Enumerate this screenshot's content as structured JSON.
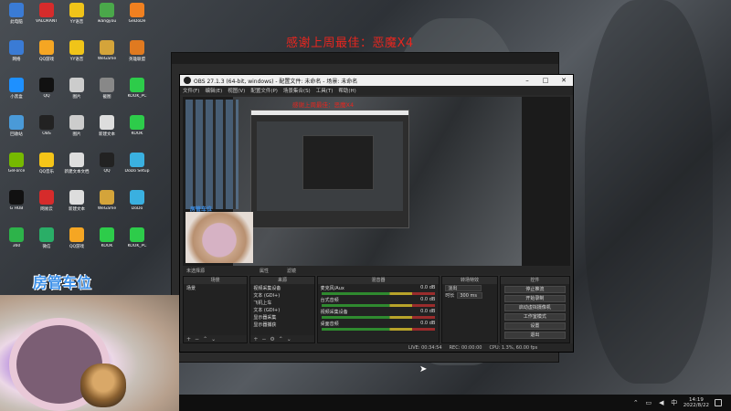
{
  "banner": "感谢上周最佳：恶魔X4",
  "desktop_icons": [
    {
      "label": "此电脑",
      "color": "#3a7bd5"
    },
    {
      "label": "VALORANT",
      "color": "#d62b2b"
    },
    {
      "label": "YY语音",
      "color": "#f0c419"
    },
    {
      "label": "wangyou",
      "color": "#4aa84a"
    },
    {
      "label": "GeDoDe",
      "color": "#f08020"
    },
    {
      "label": "网络",
      "color": "#3a7bd5"
    },
    {
      "label": "QQ游戏",
      "color": "#f5a623"
    },
    {
      "label": "YY语音",
      "color": "#f0c419"
    },
    {
      "label": "WeGame",
      "color": "#d4a43a"
    },
    {
      "label": "英雄联盟",
      "color": "#e07a20"
    },
    {
      "label": "小黑盒",
      "color": "#1e90ff"
    },
    {
      "label": "QQ",
      "color": "#111"
    },
    {
      "label": "图片",
      "color": "#cccccc"
    },
    {
      "label": "截图",
      "color": "#888"
    },
    {
      "label": "KOOK_PC",
      "color": "#2dcc4a"
    },
    {
      "label": "回收站",
      "color": "#4a9ad8"
    },
    {
      "label": "OBS",
      "color": "#222"
    },
    {
      "label": "图片",
      "color": "#cccccc"
    },
    {
      "label": "新建文本",
      "color": "#ddd"
    },
    {
      "label": "KOOK",
      "color": "#2dcc4a"
    },
    {
      "label": "GeForce",
      "color": "#76b900"
    },
    {
      "label": "QQ音乐",
      "color": "#f5c518"
    },
    {
      "label": "新建文本文档",
      "color": "#ddd"
    },
    {
      "label": "QQ",
      "color": "#222"
    },
    {
      "label": "DoDo Setup",
      "color": "#3ab0e0"
    },
    {
      "label": "G HUB",
      "color": "#111"
    },
    {
      "label": "网易云",
      "color": "#d62b2b"
    },
    {
      "label": "新建文本",
      "color": "#ddd"
    },
    {
      "label": "WeGame",
      "color": "#d4a43a"
    },
    {
      "label": "DoDo",
      "color": "#3ab0e0"
    },
    {
      "label": "360",
      "color": "#2db34a"
    },
    {
      "label": "微信",
      "color": "#2aae67"
    },
    {
      "label": "QQ游戏",
      "color": "#f5a623"
    },
    {
      "label": "KOOK",
      "color": "#2dcc4a"
    },
    {
      "label": "KOOK_PC",
      "color": "#2dcc4a"
    }
  ],
  "chat_banner": "房管车位",
  "obs": {
    "title": "OBS 27.1.3 (64-bit, windows) - 配置文件: 未命名 - 场景: 未命名",
    "controls": [
      "–",
      "□",
      "✕"
    ],
    "menu": [
      "文件(F)",
      "编辑(E)",
      "视图(V)",
      "配置文件(P)",
      "场景集合(S)",
      "工具(T)",
      "帮助(H)"
    ],
    "preview_banner": "感谢上周最佳：恶魔X4",
    "preview_cam_label": "房管车位",
    "source_label": "未选择源",
    "properties_label": "属性",
    "filters_label": "滤镜",
    "docks": {
      "scenes": {
        "title": "场景",
        "items": [
          "场景"
        ]
      },
      "sources": {
        "title": "来源",
        "items": [
          "视频采集设备",
          "文本 (GDI+)",
          "飞机上车",
          "文本 (GDI+)",
          "显示器采集",
          "显示器捕获"
        ]
      },
      "mixer": {
        "title": "混音器",
        "channels": [
          {
            "name": "麦克风/Aux",
            "level": "0.0 dB"
          },
          {
            "name": "台式音频",
            "level": "0.0 dB"
          },
          {
            "name": "视频采集设备",
            "level": "0.0 dB"
          },
          {
            "name": "桌面音频",
            "level": "0.0 dB"
          }
        ]
      },
      "transitions": {
        "title": "转场特效",
        "type": "淡出",
        "duration_label": "时长",
        "duration": "300 ms"
      },
      "controls": {
        "title": "控件",
        "buttons": [
          "停止推流",
          "开始录制",
          "启动虚拟摄像机",
          "工作室模式",
          "设置",
          "退出"
        ]
      }
    },
    "status": {
      "live": "LIVE: 00:34:54",
      "rec": "REC: 00:00:00",
      "cpu": "CPU: 1.3%, 60.00 fps"
    }
  },
  "taskbar": {
    "time": "14:19",
    "date": "2022/8/22",
    "ime": "中"
  }
}
